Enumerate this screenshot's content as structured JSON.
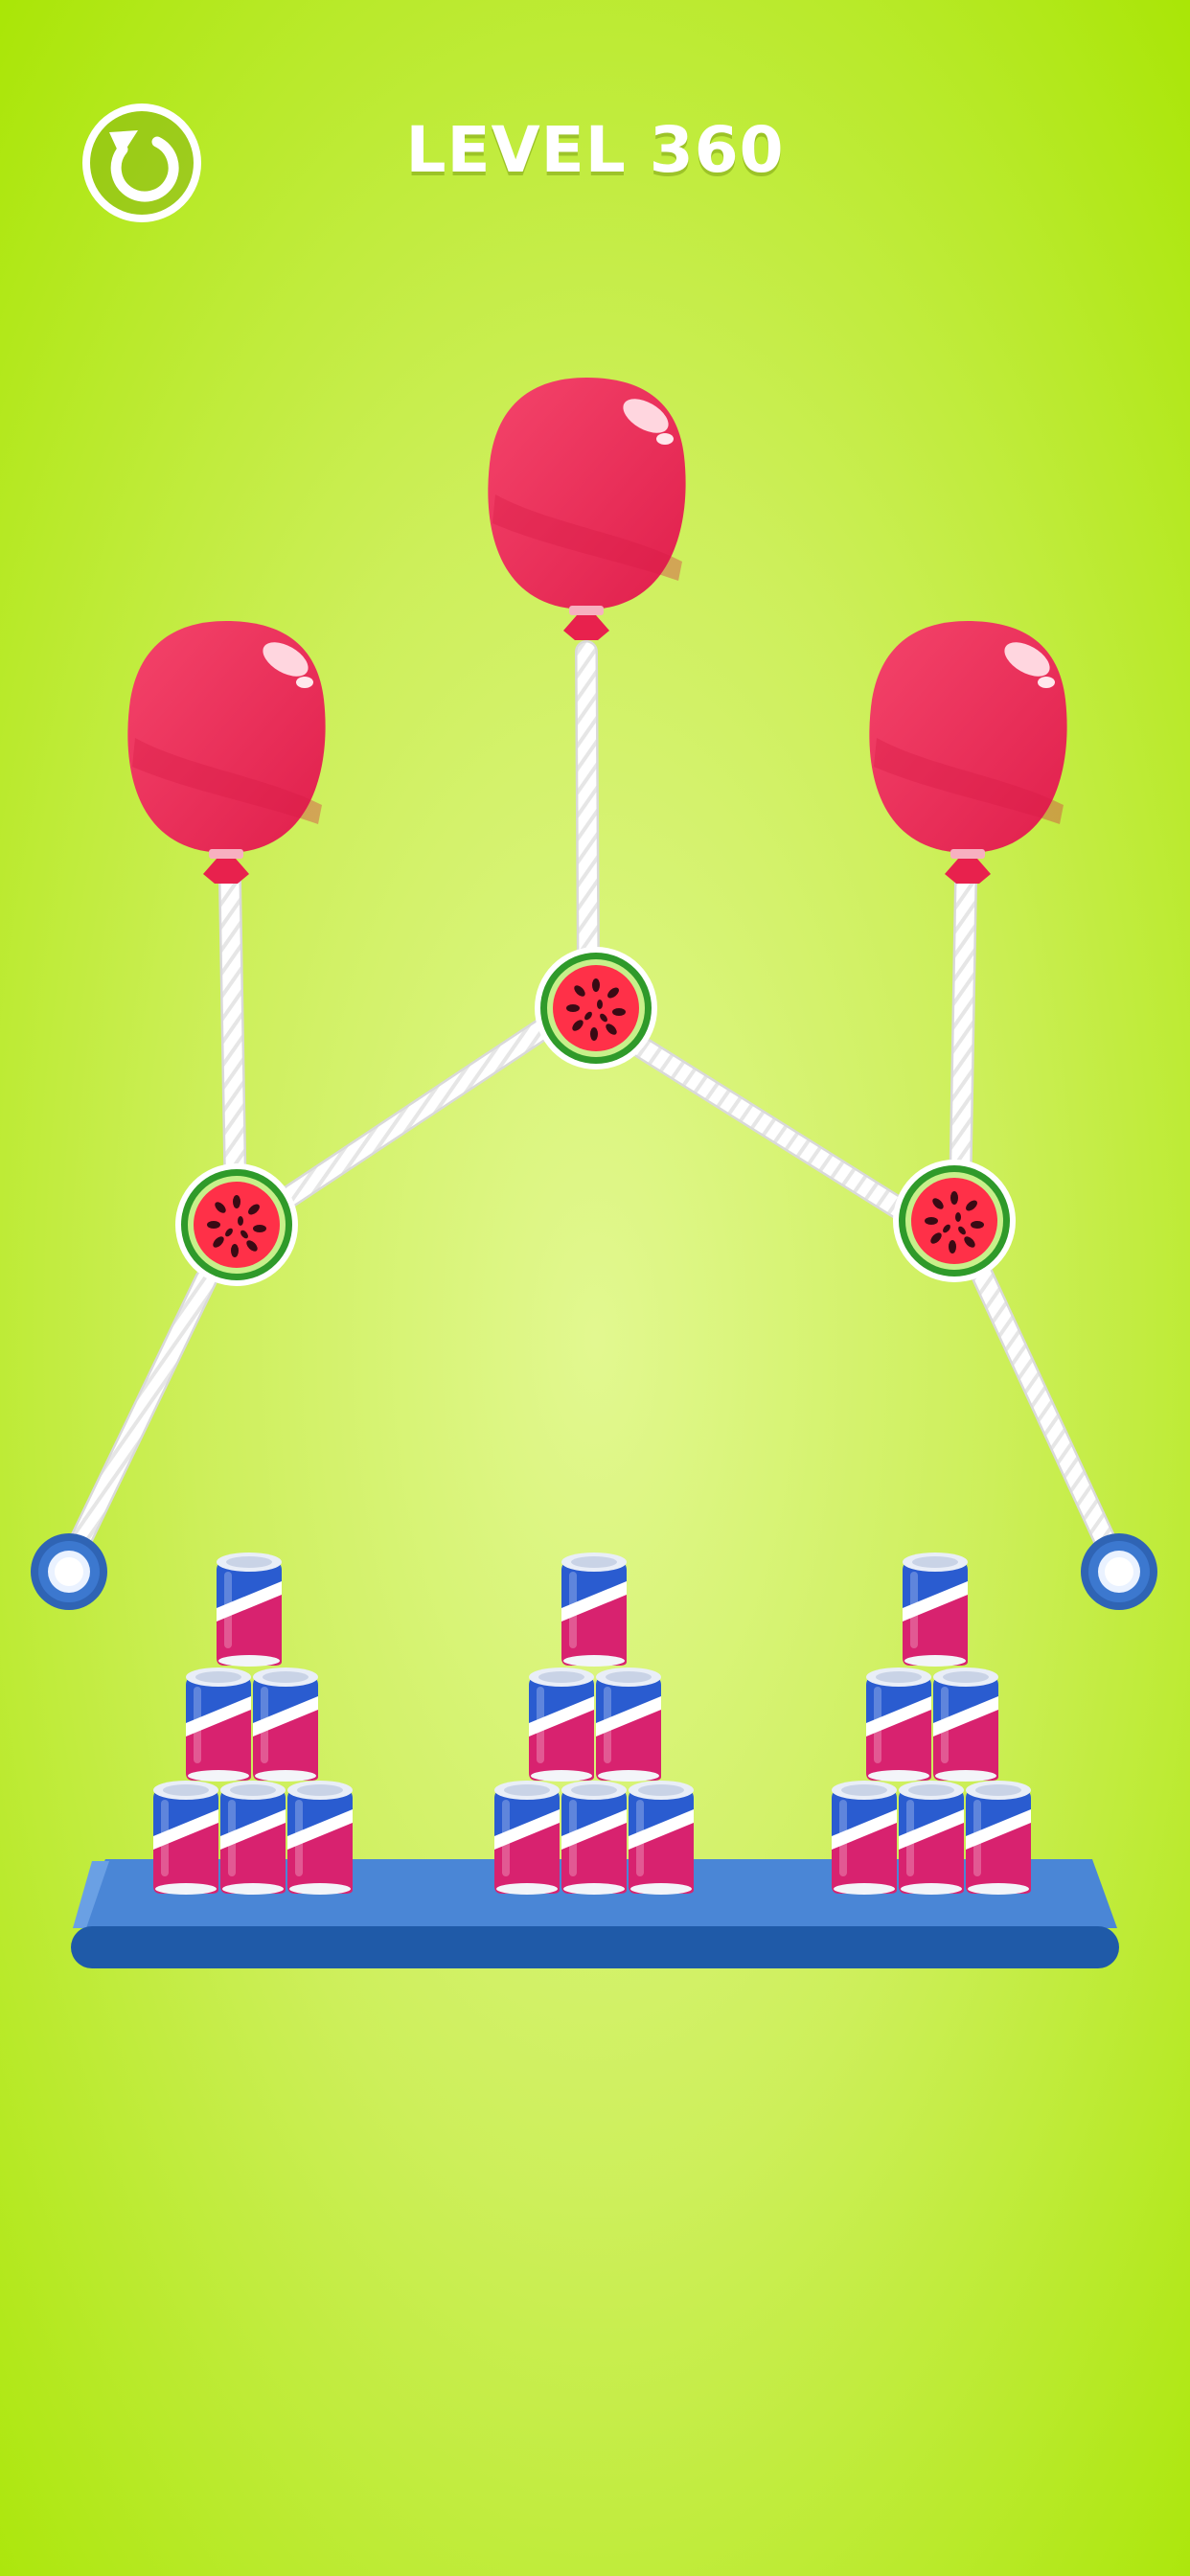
{
  "header": {
    "level_label": "LEVEL 360",
    "restart_icon": "restart-icon"
  },
  "colors": {
    "background_top": "#a8e600",
    "background_center": "#dff78a",
    "balloon": "#ef2f5a",
    "rope": "#ffffff",
    "anchor": "#2f64b4",
    "shelf": "#3473c4",
    "can_blue": "#2a5cd0",
    "can_pink": "#d8226f",
    "watermelon_flesh": "#ff3048",
    "watermelon_rind": "#2f9a2a"
  },
  "scene": {
    "balloons": [
      "balloon-left",
      "balloon-center",
      "balloon-right"
    ],
    "pins": [
      "watermelon-pin-left",
      "watermelon-pin-center",
      "watermelon-pin-right"
    ],
    "anchors": [
      "anchor-left",
      "anchor-right"
    ],
    "can_stacks": [
      {
        "name": "can-stack-left",
        "rows": [
          3,
          2,
          1
        ]
      },
      {
        "name": "can-stack-center",
        "rows": [
          3,
          2,
          1
        ]
      },
      {
        "name": "can-stack-right",
        "rows": [
          3,
          2,
          1
        ]
      }
    ]
  }
}
